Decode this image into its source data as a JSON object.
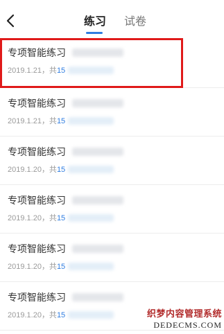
{
  "header": {
    "tabs": [
      {
        "label": "练习",
        "active": true
      },
      {
        "label": "试卷",
        "active": false
      }
    ]
  },
  "list": [
    {
      "title": "专项智能练习",
      "date": "2019.1.21",
      "count_prefix": "，共",
      "count": "15"
    },
    {
      "title": "专项智能练习",
      "date": "2019.1.21",
      "count_prefix": "，共",
      "count": "15"
    },
    {
      "title": "专项智能练习",
      "date": "2019.1.20",
      "count_prefix": "，共",
      "count": "15"
    },
    {
      "title": "专项智能练习",
      "date": "2019.1.20",
      "count_prefix": "，共",
      "count": "15"
    },
    {
      "title": "专项智能练习",
      "date": "2019.1.20",
      "count_prefix": "，共",
      "count": "15"
    },
    {
      "title": "专项智能练习",
      "date": "2019.1.20",
      "count_prefix": "，共",
      "count": "15"
    }
  ],
  "watermark": {
    "cn": "织梦内容管理系统",
    "en": "DEDECMS.COM"
  },
  "colors": {
    "accent": "#2f7de1",
    "highlight": "#e01a1a"
  },
  "icons": {
    "back": "chevron-left-icon"
  }
}
